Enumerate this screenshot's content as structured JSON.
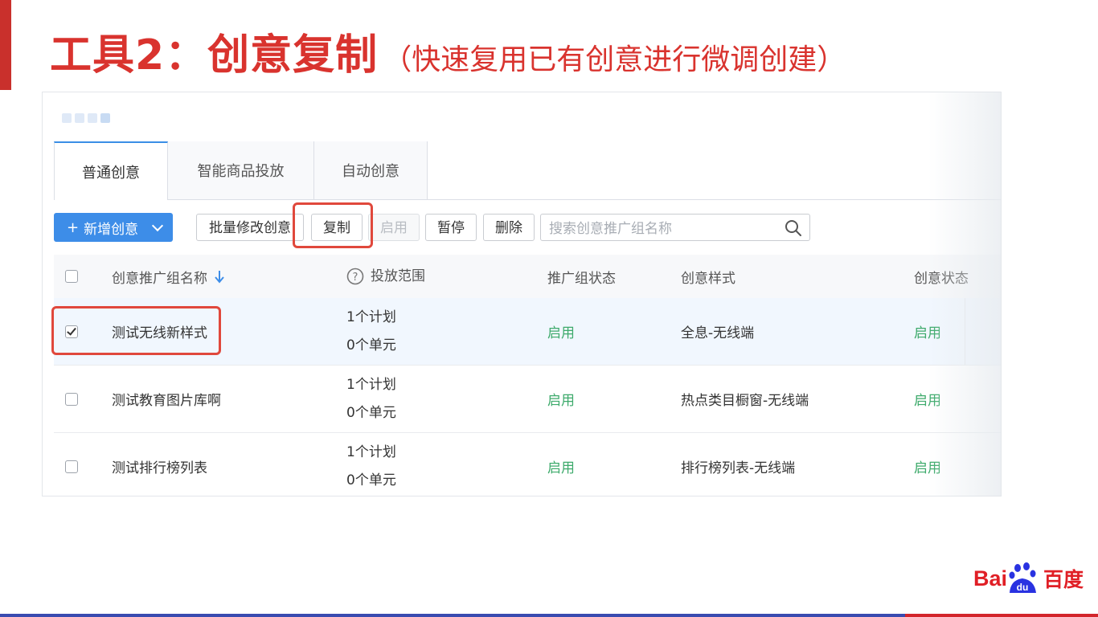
{
  "slide": {
    "title_main": "工具2：创意复制",
    "title_sub": "（快速复用已有创意进行微调创建）"
  },
  "tabs": [
    {
      "label": "普通创意",
      "active": true
    },
    {
      "label": "智能商品投放",
      "active": false
    },
    {
      "label": "自动创意",
      "active": false
    }
  ],
  "toolbar": {
    "add_label": "新增创意",
    "add_icon": "plus-icon",
    "batch_label": "批量修改创意",
    "copy_label": "复制",
    "enable_label": "启用",
    "pause_label": "暂停",
    "delete_label": "删除",
    "search_placeholder": "搜索创意推广组名称"
  },
  "table": {
    "columns": {
      "name": "创意推广组名称",
      "range": "投放范围",
      "group_status": "推广组状态",
      "style": "创意样式",
      "creative_status": "创意状态"
    },
    "rows": [
      {
        "checked": true,
        "name": "测试无线新样式",
        "plans": "1个计划",
        "units": "0个单元",
        "group_status": "启用",
        "style": "全息-无线端",
        "creative_status": "启用"
      },
      {
        "checked": false,
        "name": "测试教育图片库啊",
        "plans": "1个计划",
        "units": "0个单元",
        "group_status": "启用",
        "style": "热点类目橱窗-无线端",
        "creative_status": "启用"
      },
      {
        "checked": false,
        "name": "测试排行榜列表",
        "plans": "1个计划",
        "units": "0个单元",
        "group_status": "启用",
        "style": "排行榜列表-无线端",
        "creative_status": "启用"
      }
    ]
  },
  "logo": {
    "latin": "Bai",
    "du": "du",
    "chinese": "百度"
  },
  "colors": {
    "title_red": "#d9332e",
    "primary_blue": "#3d8de8",
    "status_green": "#3daa6b",
    "highlight_red": "#e0483c",
    "brand_red": "#e01f26",
    "brand_blue": "#2932e1"
  }
}
